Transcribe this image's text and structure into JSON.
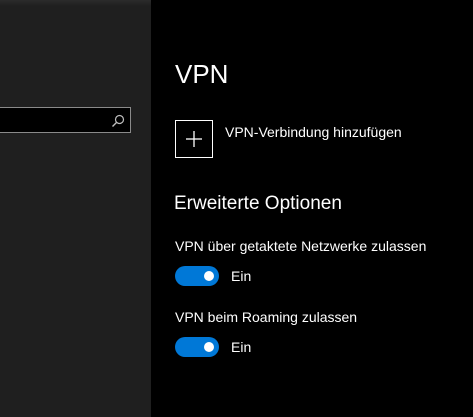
{
  "search": {
    "placeholder": "",
    "icon": "search-icon"
  },
  "page": {
    "title": "VPN"
  },
  "add_vpn": {
    "label": "VPN-Verbindung hinzufügen",
    "icon": "plus-icon"
  },
  "advanced": {
    "title": "Erweiterte Optionen",
    "options": [
      {
        "label": "VPN über getaktete Netzwerke zulassen",
        "state": "Ein",
        "on": true
      },
      {
        "label": "VPN beim Roaming zulassen",
        "state": "Ein",
        "on": true
      }
    ]
  },
  "colors": {
    "accent": "#0078d7",
    "background": "#000000",
    "nav_background": "#1f1f1f"
  }
}
